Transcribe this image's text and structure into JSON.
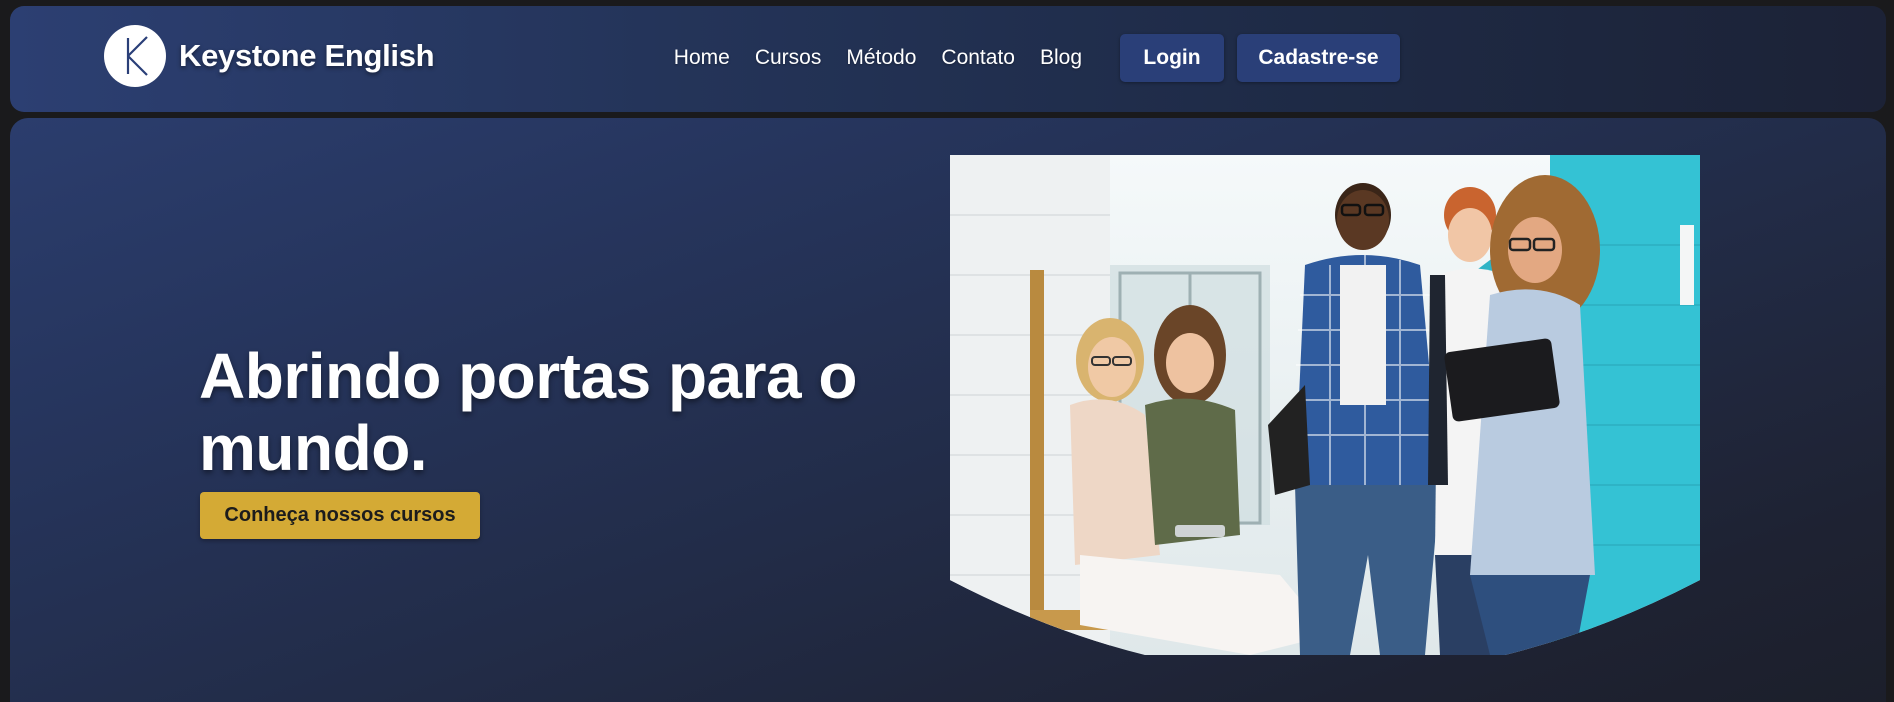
{
  "header": {
    "brand": "Keystone English",
    "logo_letter": "K",
    "nav": [
      "Home",
      "Cursos",
      "Método",
      "Contato",
      "Blog"
    ],
    "login_label": "Login",
    "signup_label": "Cadastre-se"
  },
  "hero": {
    "title": "Abrindo portas para o mundo.",
    "cta_label": "Conheça nossos cursos",
    "image_icon": "students-photo"
  },
  "colors": {
    "nav_button": "#2a3f78",
    "cta": "#d4aa35",
    "hero_bg": "#26355d",
    "page_bg": "#1a1a1c"
  }
}
